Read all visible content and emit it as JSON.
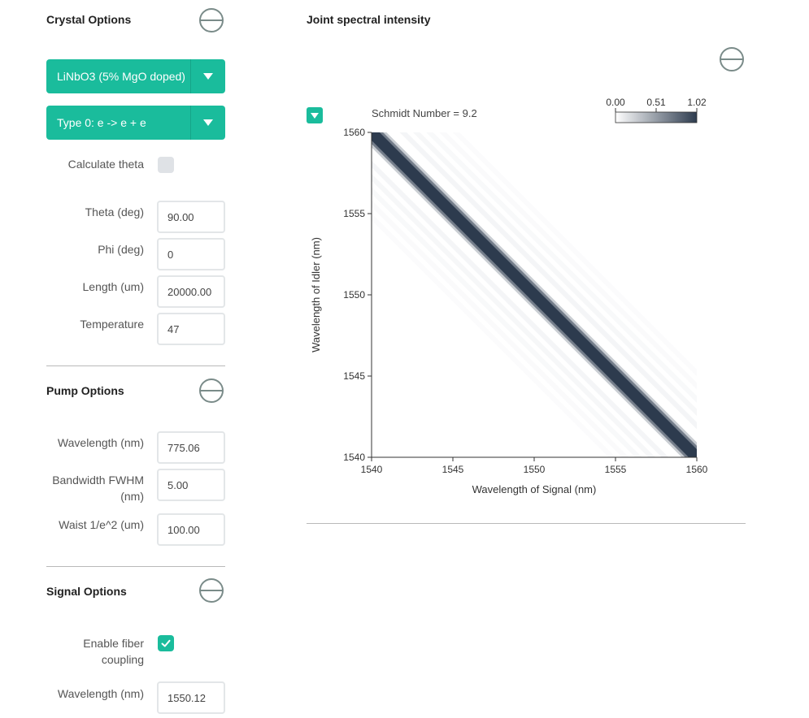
{
  "crystal": {
    "title": "Crystal Options",
    "material": "LiNbO3 (5% MgO doped)",
    "type": "Type 0: e -> e + e",
    "calc_theta_label": "Calculate theta",
    "calc_theta_checked": false,
    "fields": [
      {
        "label": "Theta (deg)",
        "value": "90.00"
      },
      {
        "label": "Phi (deg)",
        "value": "0"
      },
      {
        "label": "Length (um)",
        "value": "20000.00"
      },
      {
        "label": "Temperature",
        "value": "47"
      }
    ]
  },
  "pump": {
    "title": "Pump Options",
    "fields": [
      {
        "label": "Wavelength (nm)",
        "value": "775.06"
      },
      {
        "label": "Bandwidth FWHM (nm)",
        "value": "5.00"
      },
      {
        "label": "Waist 1/e^2 (um)",
        "value": "100.00"
      }
    ]
  },
  "signal": {
    "title": "Signal Options",
    "fiber_label": "Enable fiber coupling",
    "fiber_checked": true,
    "fields": [
      {
        "label": "Wavelength (nm)",
        "value": "1550.12"
      }
    ]
  },
  "jsi": {
    "title": "Joint spectral intensity",
    "schmidt_text": "Schmidt Number = 9.2"
  },
  "colors": {
    "accent": "#1abc9c",
    "band": "#2d3b4e"
  },
  "chart_data": {
    "type": "heatmap",
    "xlabel": "Wavelength of Signal (nm)",
    "ylabel": "Wavelength of Idler (nm)",
    "xlim": [
      1540,
      1560
    ],
    "ylim": [
      1540,
      1560
    ],
    "x_ticks": [
      "1540",
      "1545",
      "1550",
      "1555",
      "1560"
    ],
    "y_ticks": [
      "1540",
      "1545",
      "1550",
      "1555",
      "1560"
    ],
    "colorbar": {
      "min": 0.0,
      "max": 1.02,
      "ticks": [
        "0.00",
        "0.51",
        "1.02"
      ],
      "colors": [
        "#ffffff",
        "#2d3b4e"
      ]
    },
    "band": {
      "description": "Anti-diagonal band: signal + idler = const",
      "sum_nm": 3100,
      "peak_value": 1.02,
      "fringe_count_each_side": 5
    }
  }
}
